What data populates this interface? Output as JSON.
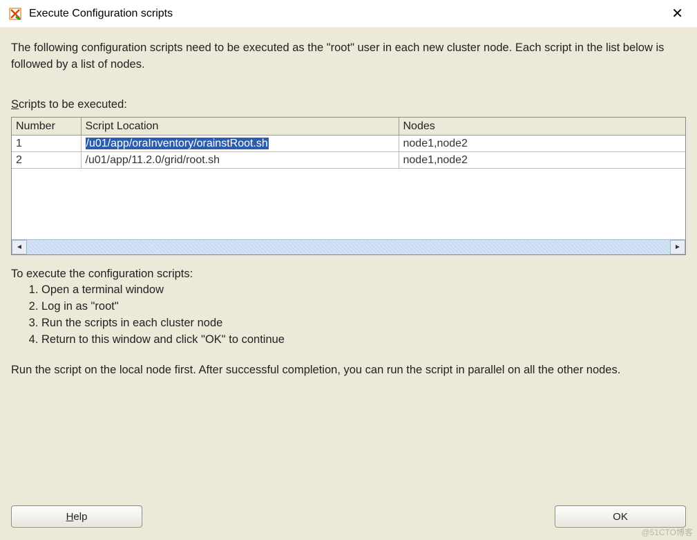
{
  "titlebar": {
    "title": "Execute Configuration scripts"
  },
  "intro": "The following configuration scripts need to be executed as the \"root\" user in each new cluster node. Each script in the list below is followed by a list of nodes.",
  "section_label_pre": "S",
  "section_label_rest": "cripts to be executed:",
  "table": {
    "headers": {
      "number": "Number",
      "location": "Script Location",
      "nodes": "Nodes"
    },
    "rows": [
      {
        "number": "1",
        "location": "/u01/app/oraInventory/orainstRoot.sh",
        "nodes": "node1,node2",
        "selected": true
      },
      {
        "number": "2",
        "location": "/u01/app/11.2.0/grid/root.sh",
        "nodes": "node1,node2",
        "selected": false
      }
    ]
  },
  "instructions_heading": "To execute the configuration scripts:",
  "instructions": [
    "Open a terminal window",
    "Log in as \"root\"",
    "Run the scripts in each cluster node",
    "Return to this window and click \"OK\" to continue"
  ],
  "final_note": "Run the script on the local node first. After successful completion, you can run the script in parallel on all the other nodes.",
  "buttons": {
    "help_mnemonic": "H",
    "help_rest": "elp",
    "ok": "OK"
  },
  "watermark": "@51CTO博客"
}
